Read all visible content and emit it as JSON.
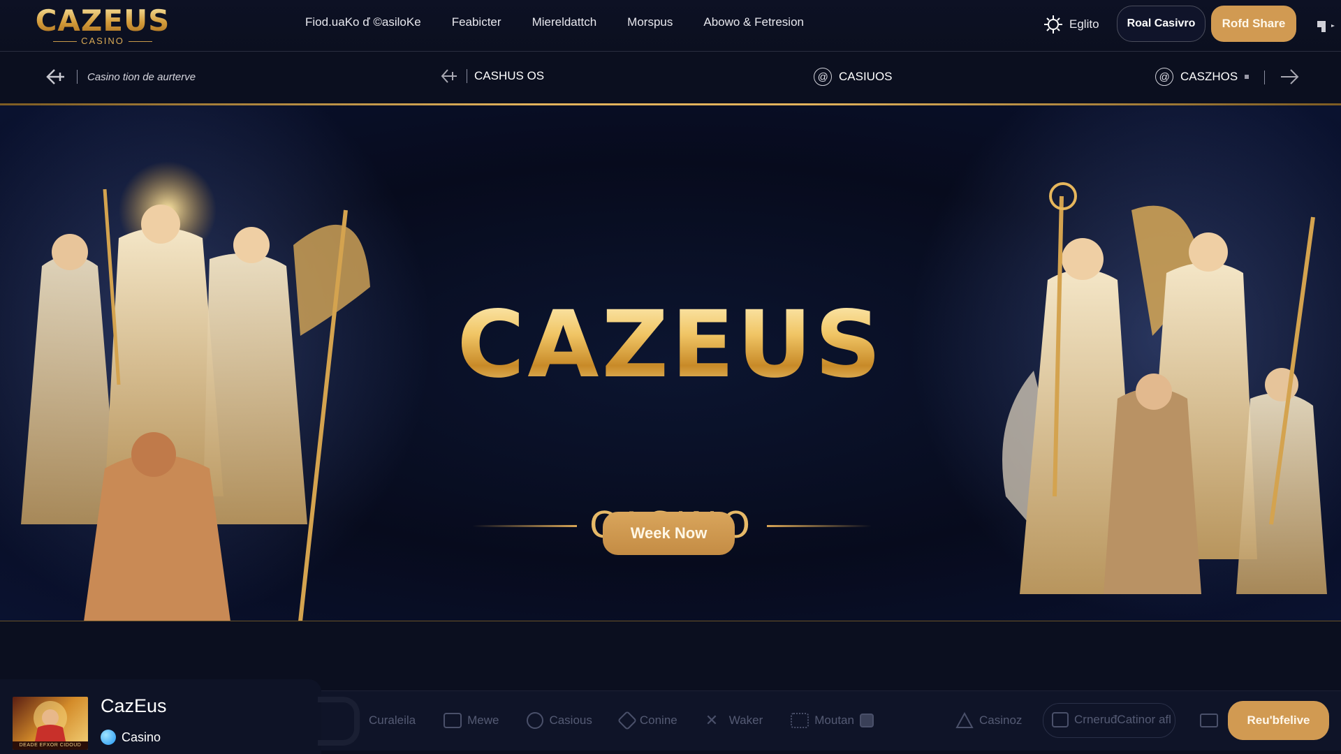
{
  "header": {
    "logo_main": "CAZEUS",
    "logo_sub": "CASINO",
    "nav": [
      "Fiod.uaKo ď ©asiloKe",
      "Feabicter",
      "Miereldattch",
      "Morspus",
      "Abowo & Fetresion"
    ],
    "language": "Eglito",
    "real_casino_button": "Roal Casivro",
    "share_button": "Rofd Share"
  },
  "subbar": {
    "breadcrumb": "Casino tion de aurterve",
    "item1": "CASHUS OS",
    "item2": "CASIUOS",
    "item3": "CASZHOS"
  },
  "hero": {
    "title": "CAZEUS",
    "subtitle": "CASINO",
    "cta": "Week Now"
  },
  "dock": {
    "items": [
      "Curaleila",
      "Mewe",
      "Casious",
      "Conine",
      "Waker",
      "Moutan"
    ],
    "casinoz": "Casinoz",
    "pill": "CrneruđCatinor afl",
    "button": "Reu'bfelive"
  },
  "profile": {
    "name": "CazEus",
    "category": "Casino",
    "thumb_caption": "DEADE EFXOR CIDOUD"
  },
  "colors": {
    "background": "#0b0f1f",
    "gold": "#d19a52",
    "gold_light": "#f0c565"
  }
}
